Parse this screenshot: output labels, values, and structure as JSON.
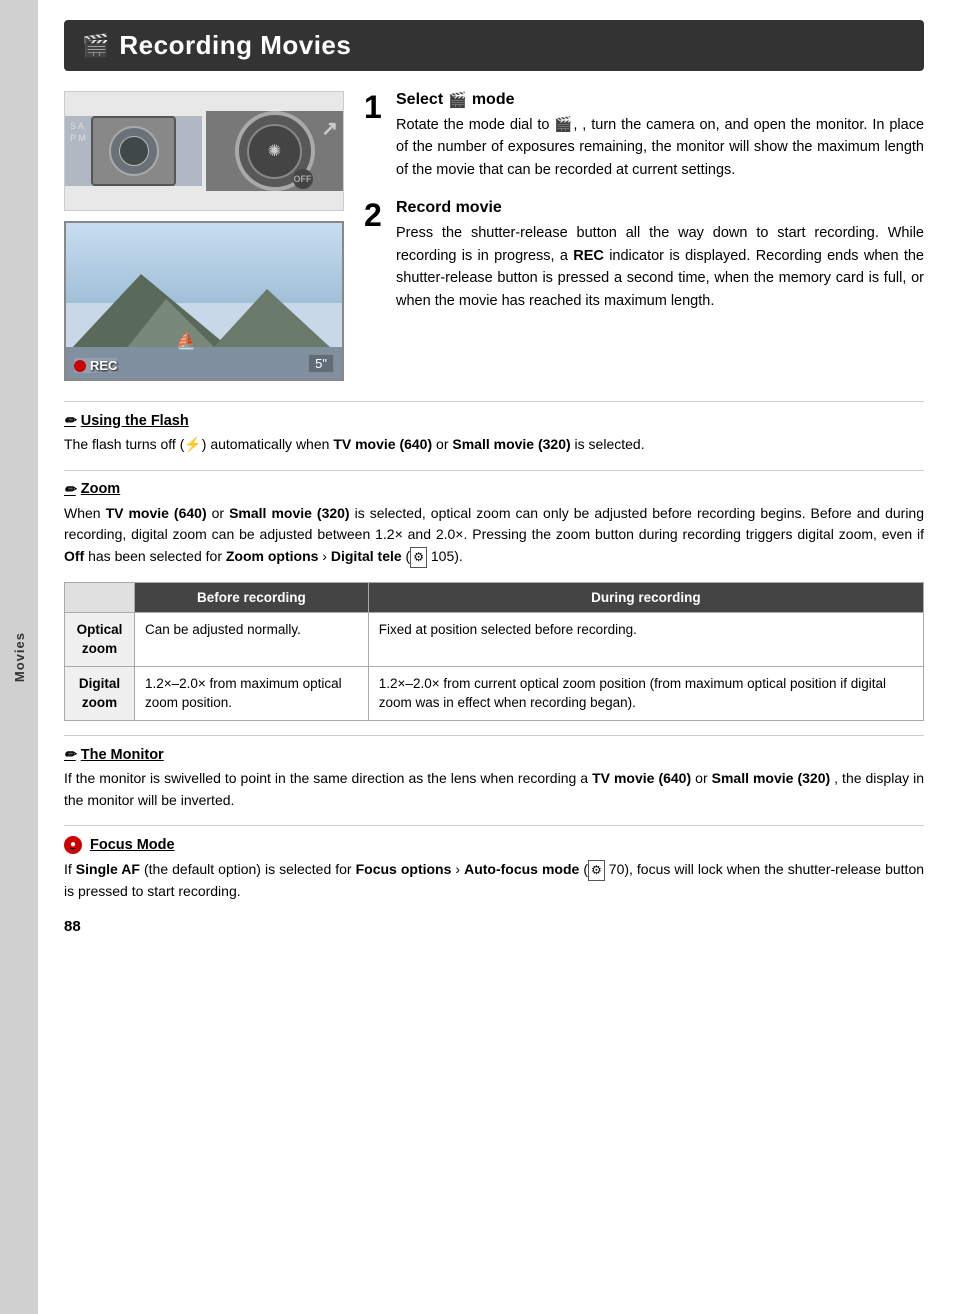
{
  "sidebar": {
    "label": "Movies"
  },
  "header": {
    "title": "Recording Movies",
    "icon": "🎬"
  },
  "step1": {
    "number": "1",
    "title": "Select",
    "title_suffix": "mode",
    "body": "Rotate the mode dial to",
    "body2": ", turn the camera on, and open the monitor.  In place of the number of exposures remaining, the monitor will show the maximum length of the movie that can be recorded at current settings."
  },
  "step2": {
    "number": "2",
    "title": "Record movie",
    "body": "Press the shutter-release button all the way down to start recording.  While recording is in progress, a",
    "rec_bold": "REC",
    "body2": "indicator is displayed. Recording ends when the shutter-release button is pressed a second time, when the memory card is full, or when the movie has reached its maximum length."
  },
  "monitor": {
    "rec_label": "REC",
    "timer": "5\""
  },
  "note_flash": {
    "heading": "Using the Flash",
    "body_pre": "The flash turns off (",
    "flash_sym": "⚡",
    "body_mid": ") automatically when",
    "bold1": "TV movie (640)",
    "body_mid2": "or",
    "bold2": "Small movie (320)",
    "body_end": "is selected."
  },
  "note_zoom": {
    "heading": "Zoom",
    "body_pre": "When",
    "bold1": "TV movie (640)",
    "body_mid": "or",
    "bold2": "Small movie (320)",
    "body_mid2": "is selected, optical zoom can only be adjusted before recording begins.  Before and during recording, digital zoom can be adjusted between 1.2× and 2.0×.  Pressing the zoom button during recording triggers digital zoom, even if",
    "bold3": "Off",
    "body_end": "has been selected for",
    "bold4": "Zoom options",
    "arrow": "›",
    "bold5": "Digital tele",
    "ref": "105"
  },
  "table": {
    "col_empty": "",
    "col_before": "Before recording",
    "col_during": "During recording",
    "rows": [
      {
        "label": "Optical zoom",
        "before": "Can be adjusted normally.",
        "during": "Fixed at position selected before recording."
      },
      {
        "label": "Digital zoom",
        "before": "1.2×–2.0×  from  maximum optical zoom position.",
        "during": "1.2×–2.0× from current optical zoom position (from maximum optical position if digital zoom was in effect when recording began)."
      }
    ]
  },
  "note_monitor": {
    "heading": "The Monitor",
    "body_pre": "If the monitor is swivelled to point in the same direction as the lens when recording a",
    "bold1": "TV movie (640)",
    "body_mid": "or",
    "bold2": "Small movie (320)",
    "body_end": ",  the display in the monitor will be inverted."
  },
  "note_focus": {
    "heading": "Focus Mode",
    "body_pre": "If",
    "bold1": "Single AF",
    "body_mid": "(the default option) is selected for",
    "bold2": "Focus options",
    "arrow": "›",
    "bold3": "Auto-focus mode",
    "ref": "70",
    "body_end": "), focus will lock when the shutter-release button is pressed to start recording."
  },
  "page_number": "88"
}
